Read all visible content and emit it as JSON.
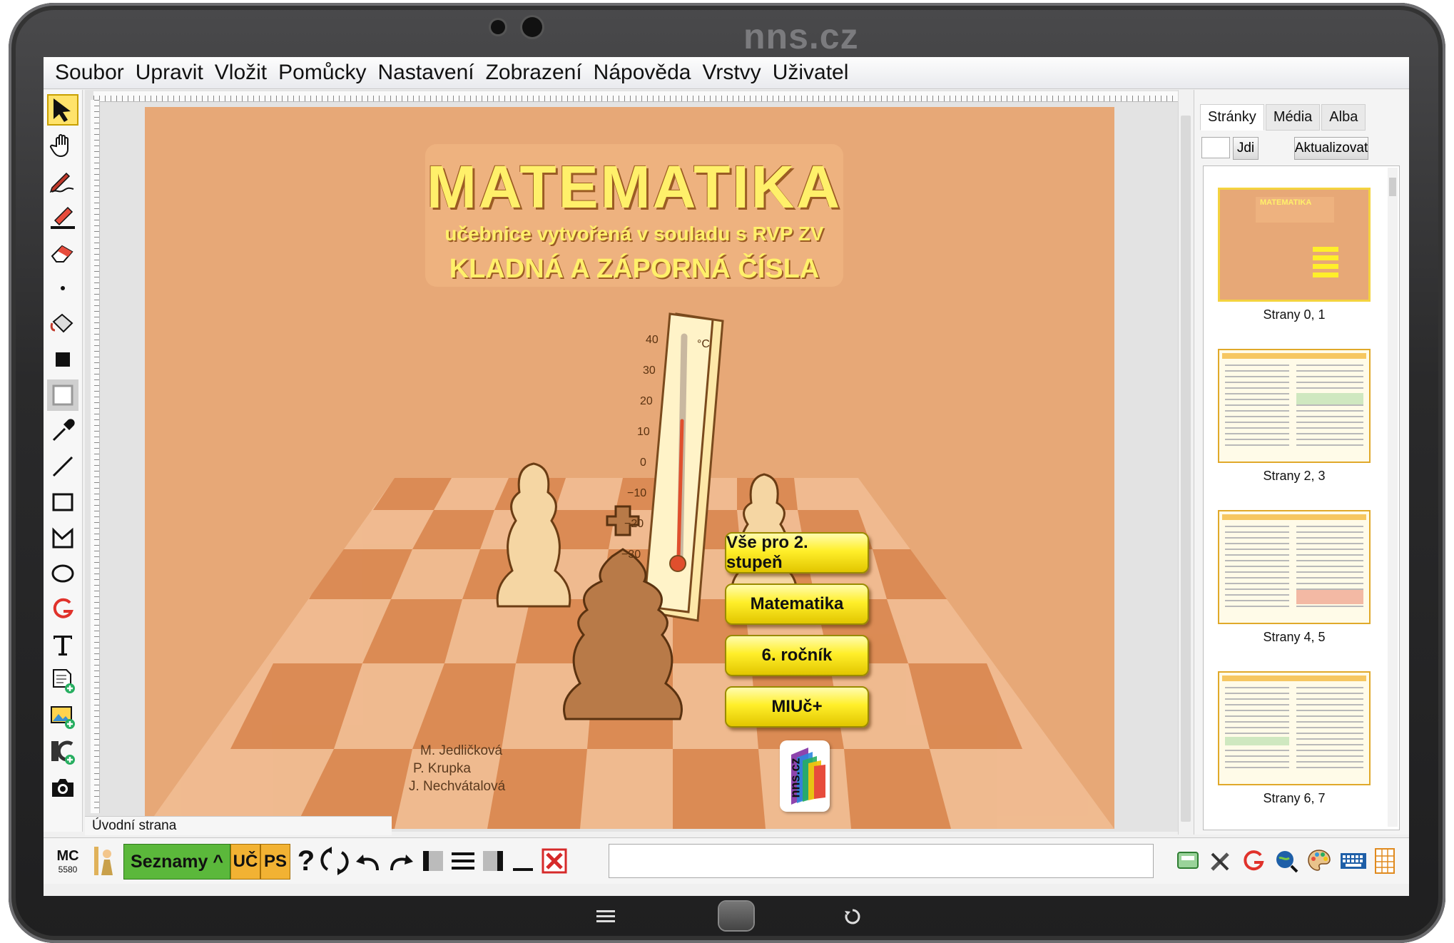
{
  "device": {
    "brand": "nns.cz"
  },
  "menu": [
    "Soubor",
    "Upravit",
    "Vložit",
    "Pomůcky",
    "Nastavení",
    "Zobrazení",
    "Nápověda",
    "Vrstvy",
    "Uživatel"
  ],
  "tools": [
    "pointer-icon",
    "hand-icon",
    "pen-icon",
    "highlighter-icon",
    "eraser-icon",
    "dot-icon",
    "fill-bucket-icon",
    "filled-square-icon",
    "frame-square-icon",
    "eyedropper-icon",
    "line-icon",
    "rectangle-icon",
    "polygon-icon",
    "ellipse-icon",
    "geogebra-icon",
    "text-icon",
    "add-page-icon",
    "add-image-icon",
    "add-interactive-icon",
    "camera-icon"
  ],
  "page": {
    "title": "MATEMATIKA",
    "subtitle": "učebnice vytvořená v souladu s RVP ZV",
    "topic": "KLADNÁ A ZÁPORNÁ ČÍSLA",
    "thermometer": {
      "unit": "°C",
      "ticks": [
        "40",
        "30",
        "20",
        "10",
        "0",
        "−10",
        "−20",
        "−30"
      ]
    },
    "authors": [
      "M. Jedličková",
      "P. Krupka",
      "J. Nechvátalová"
    ],
    "buttons": [
      "Vše pro 2. stupeň",
      "Matematika",
      "6. ročník",
      "MIUč+"
    ],
    "logo_text": "nns.cz"
  },
  "status_tab": "Úvodní strana",
  "sidebar": {
    "tabs": [
      "Stránky",
      "Média",
      "Alba"
    ],
    "go_button": "Jdi",
    "refresh_button": "Aktualizovat",
    "pages": [
      "Strany 0, 1",
      "Strany 2, 3",
      "Strany 4, 5",
      "Strany 6, 7"
    ]
  },
  "bottombar": {
    "mc_label": "MC",
    "mc_number": "5580",
    "lists_button": "Seznamy ^",
    "uc_button": "UČ",
    "ps_button": "PS"
  },
  "colors": {
    "page_bg": "#e7a877",
    "title_yellow": "#fff06a",
    "button_yellow": "#ffef2a",
    "lists_green": "#5bb83b"
  }
}
